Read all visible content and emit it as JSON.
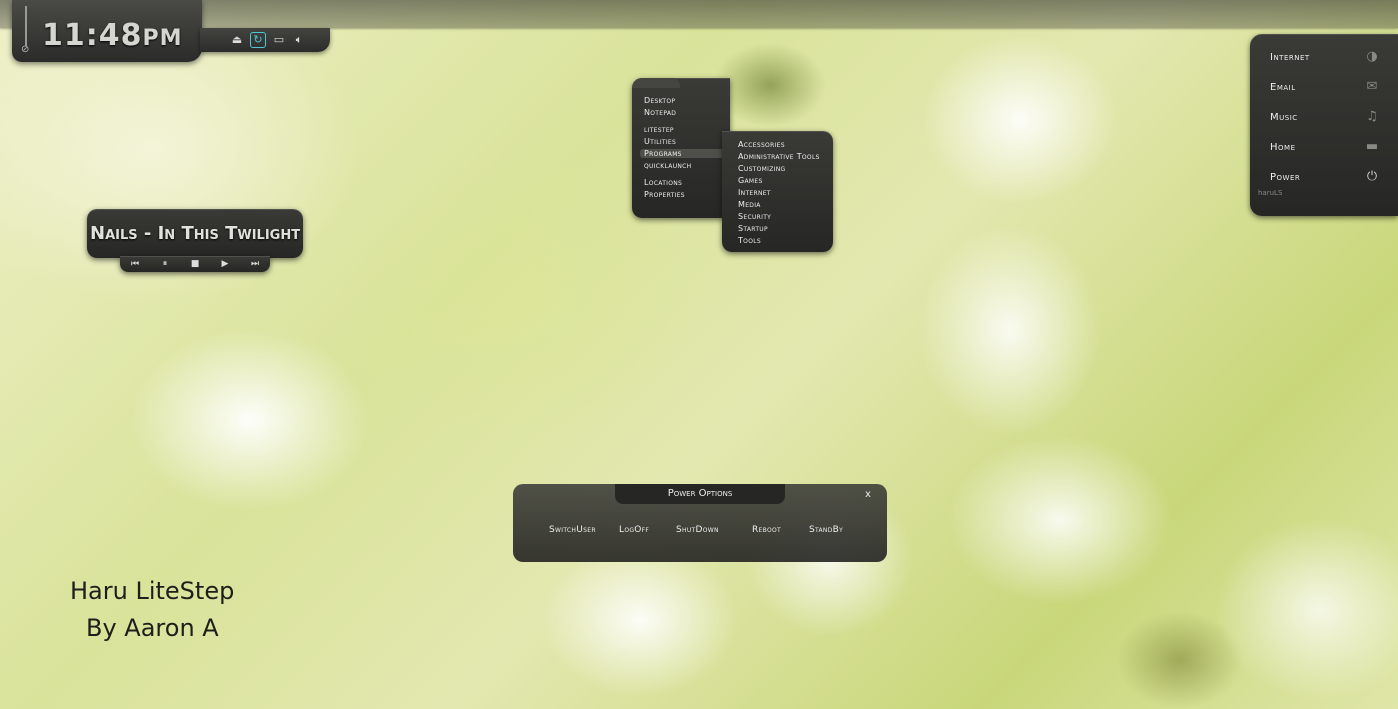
{
  "clock": {
    "time": "11:48",
    "ampm": "PM"
  },
  "tray": {
    "icons": [
      "eject-icon",
      "refresh-icon",
      "monitor-icon",
      "speaker-icon"
    ]
  },
  "quick_panel": {
    "items": [
      {
        "label": "Internet",
        "icon": "globe-icon"
      },
      {
        "label": "Email",
        "icon": "envelope-icon"
      },
      {
        "label": "Music",
        "icon": "music-note-icon"
      },
      {
        "label": "Home",
        "icon": "monitor-icon"
      },
      {
        "label": "Power",
        "icon": "power-icon"
      }
    ],
    "tag": "haruLS"
  },
  "main_menu": {
    "items": [
      "Desktop",
      "Notepad",
      "litestep",
      "Utilities",
      "Programs",
      "quicklaunch",
      "Locations",
      "Properties"
    ],
    "selected": "Programs"
  },
  "sub_menu": {
    "items": [
      "Accessories",
      "Administrative Tools",
      "Customizing",
      "Games",
      "Internet",
      "Media",
      "Security",
      "Startup",
      "Tools"
    ]
  },
  "player": {
    "track": "Nails - In This Twilight",
    "controls": [
      "previous",
      "pause",
      "stop",
      "play",
      "next"
    ]
  },
  "power_dialog": {
    "title": "Power Options",
    "close": "x",
    "buttons": [
      "SwitchUser",
      "LogOff",
      "ShutDown",
      "Reboot",
      "StandBy"
    ]
  },
  "credits": {
    "line1": "Haru LiteStep",
    "line2": "By Aaron A"
  }
}
